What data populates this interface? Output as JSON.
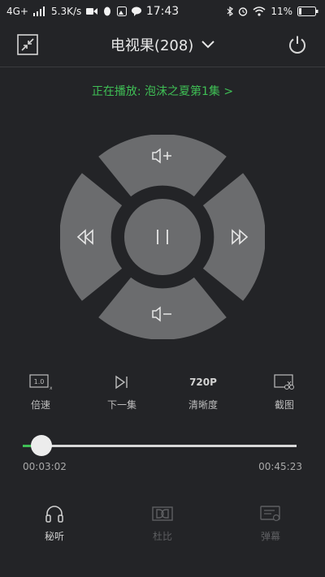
{
  "status_bar": {
    "network": "4G+",
    "speed": "5.3K/s",
    "time": "17:43",
    "battery": "11%"
  },
  "header": {
    "title": "电视果(208)",
    "left_icon": "shrink-icon",
    "right_icon": "power-icon"
  },
  "now_playing": "正在播放: 泡沫之夏第1集 >",
  "controls": [
    {
      "label": "倍速",
      "icon": "speed-icon"
    },
    {
      "label": "下一集",
      "icon": "next-episode-icon"
    },
    {
      "label": "清晰度",
      "icon": "resolution-icon",
      "icon_text": "720P"
    },
    {
      "label": "截图",
      "icon": "screenshot-icon"
    }
  ],
  "speed_icon_text": "1.0",
  "progress": {
    "elapsed": "00:03:02",
    "total": "00:45:23",
    "fraction": 0.067
  },
  "bottom_actions": [
    {
      "label": "秘听",
      "icon": "headphones-icon",
      "enabled": true
    },
    {
      "label": "杜比",
      "icon": "dolby-icon",
      "enabled": false
    },
    {
      "label": "弹幕",
      "icon": "danmaku-icon",
      "enabled": false
    }
  ],
  "colors": {
    "background": "#232427",
    "accent": "#3fbf55",
    "pad": "#6b6c6e"
  }
}
